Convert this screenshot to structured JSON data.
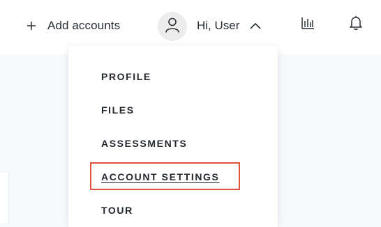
{
  "header": {
    "add_accounts_label": "Add accounts",
    "greeting": "Hi, User"
  },
  "dropdown": {
    "items": [
      {
        "label": "PROFILE"
      },
      {
        "label": "FILES"
      },
      {
        "label": "ASSESSMENTS"
      },
      {
        "label": "ACCOUNT SETTINGS"
      },
      {
        "label": "TOUR"
      }
    ]
  },
  "icons": {
    "add": "plus-icon",
    "avatar": "user-icon",
    "expand": "chevron-up-icon",
    "analytics": "bar-chart-icon",
    "notifications": "bell-icon"
  },
  "colors": {
    "highlight": "#e0533b",
    "header_bg": "#ffffff",
    "page_bg": "#f7fafd"
  }
}
